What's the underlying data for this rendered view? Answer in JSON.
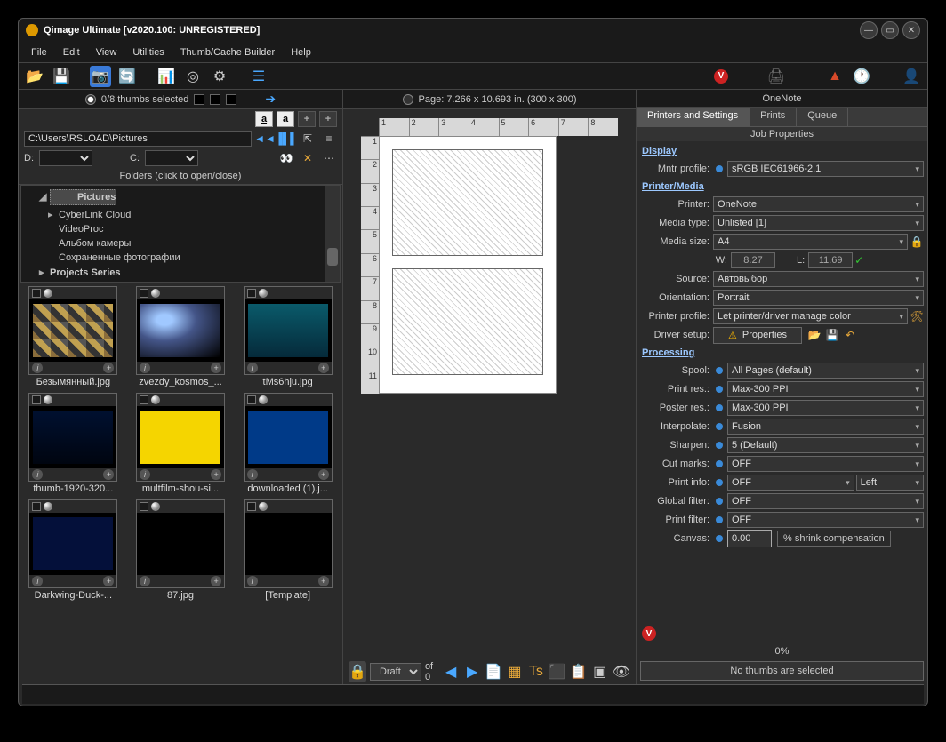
{
  "title": "Qimage Ultimate [v2020.100: UNREGISTERED]",
  "menu": [
    "File",
    "Edit",
    "View",
    "Utilities",
    "Thumb/Cache Builder",
    "Help"
  ],
  "thumbhdr": "0/8 thumbs selected",
  "path": "C:\\Users\\RSLOAD\\Pictures",
  "drive_d": "D:",
  "drive_c": "C:",
  "folderhdr": "Folders (click to open/close)",
  "folders": [
    "Pictures",
    "CyberLink Cloud",
    "VideoProc",
    "Альбом камеры",
    "Сохраненные фотографии",
    "Projects Series"
  ],
  "thumbs": [
    {
      "label": "Безымянный.jpg",
      "cls": "img0"
    },
    {
      "label": "zvezdy_kosmos_...",
      "cls": "img1"
    },
    {
      "label": "tMs6hju.jpg",
      "cls": "img2"
    },
    {
      "label": "thumb-1920-320...",
      "cls": "img3"
    },
    {
      "label": "multfilm-shou-si...",
      "cls": "img4"
    },
    {
      "label": "downloaded (1).j...",
      "cls": "img5"
    },
    {
      "label": "Darkwing-Duck-...",
      "cls": "img6"
    },
    {
      "label": "87.jpg",
      "cls": "img7"
    },
    {
      "label": "[Template]",
      "cls": ""
    }
  ],
  "pagehdr": "Page: 7.266 x 10.693 in.  (300 x 300)",
  "draft": "Draft",
  "of0": "of 0",
  "printer_name": "OneNote",
  "tabs": [
    "Printers and Settings",
    "Prints",
    "Queue"
  ],
  "jobhdr": "Job Properties",
  "sect_display": "Display",
  "sect_printer": "Printer/Media",
  "sect_processing": "Processing",
  "props": {
    "mntr": {
      "lbl": "Mntr profile:",
      "val": "sRGB IEC61966-2.1"
    },
    "printer": {
      "lbl": "Printer:",
      "val": "OneNote"
    },
    "mediatype": {
      "lbl": "Media type:",
      "val": "Unlisted [1]"
    },
    "mediasize": {
      "lbl": "Media size:",
      "val": "A4"
    },
    "w": {
      "lbl": "W:",
      "val": "8.27"
    },
    "l": {
      "lbl": "L:",
      "val": "11.69"
    },
    "source": {
      "lbl": "Source:",
      "val": "Автовыбор"
    },
    "orientation": {
      "lbl": "Orientation:",
      "val": "Portrait"
    },
    "printerprofile": {
      "lbl": "Printer profile:",
      "val": "Let printer/driver manage color"
    },
    "driversetup": {
      "lbl": "Driver setup:",
      "val": "Properties"
    },
    "spool": {
      "lbl": "Spool:",
      "val": "All Pages (default)"
    },
    "printres": {
      "lbl": "Print res.:",
      "val": "Max-300 PPI"
    },
    "posterres": {
      "lbl": "Poster res.:",
      "val": "Max-300 PPI"
    },
    "interpolate": {
      "lbl": "Interpolate:",
      "val": "Fusion"
    },
    "sharpen": {
      "lbl": "Sharpen:",
      "val": "5 (Default)"
    },
    "cutmarks": {
      "lbl": "Cut marks:",
      "val": "OFF"
    },
    "printinfo": {
      "lbl": "Print info:",
      "val": "OFF",
      "val2": "Left"
    },
    "globalfilter": {
      "lbl": "Global filter:",
      "val": "OFF"
    },
    "printfilter": {
      "lbl": "Print filter:",
      "val": "OFF"
    },
    "canvas": {
      "lbl": "Canvas:",
      "val": "0.00",
      "suffix": "% shrink compensation"
    }
  },
  "progress": "0%",
  "status": "No thumbs are selected"
}
